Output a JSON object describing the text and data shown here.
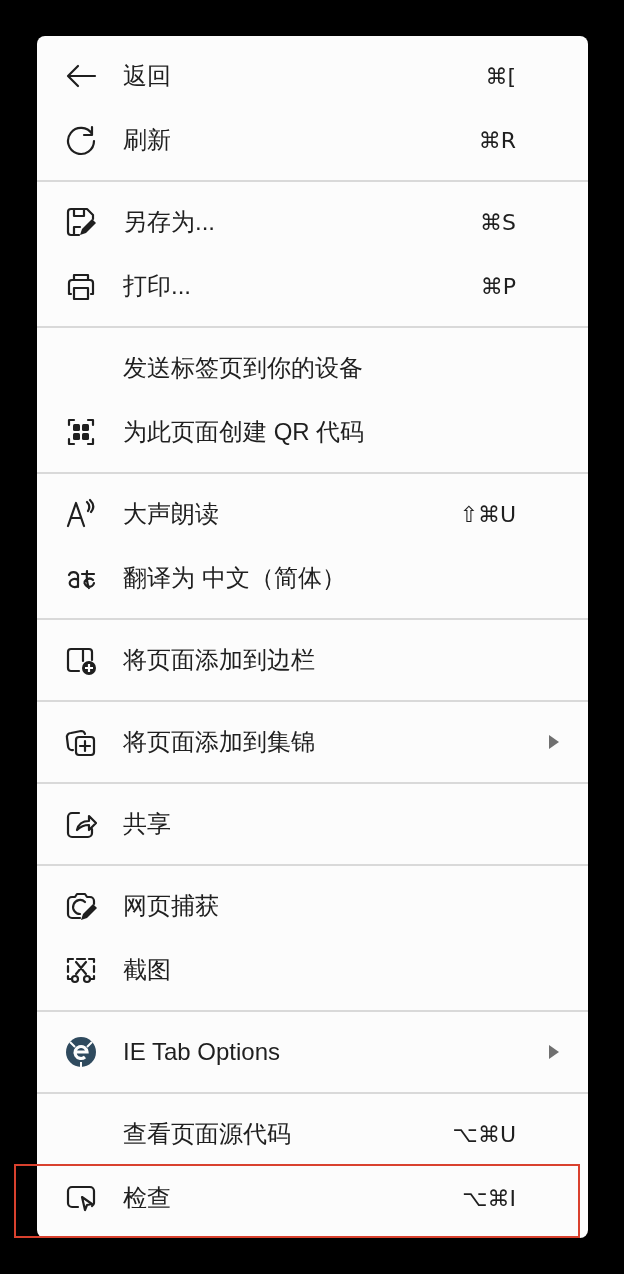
{
  "menu": {
    "groups": [
      {
        "items": [
          {
            "label": "返回",
            "shortcut": "⌘[",
            "submenu": false,
            "highlighted": false
          },
          {
            "label": "刷新",
            "shortcut": "⌘R",
            "submenu": false,
            "highlighted": false
          }
        ]
      },
      {
        "items": [
          {
            "label": "另存为...",
            "shortcut": "⌘S",
            "submenu": false,
            "highlighted": false
          },
          {
            "label": "打印...",
            "shortcut": "⌘P",
            "submenu": false,
            "highlighted": false
          }
        ]
      },
      {
        "items": [
          {
            "label": "发送标签页到你的设备",
            "submenu": false,
            "highlighted": false
          },
          {
            "label": "为此页面创建 QR 代码",
            "submenu": false,
            "highlighted": false
          }
        ]
      },
      {
        "items": [
          {
            "label": "大声朗读",
            "shortcut": "⇧⌘U",
            "submenu": false,
            "highlighted": false
          },
          {
            "label": "翻译为 中文（简体）",
            "submenu": false,
            "highlighted": false
          }
        ]
      },
      {
        "items": [
          {
            "label": "将页面添加到边栏",
            "submenu": false,
            "highlighted": false
          }
        ]
      },
      {
        "items": [
          {
            "label": "将页面添加到集锦",
            "submenu": true,
            "highlighted": false
          }
        ]
      },
      {
        "items": [
          {
            "label": "共享",
            "submenu": false,
            "highlighted": false
          }
        ]
      },
      {
        "items": [
          {
            "label": "网页捕获",
            "submenu": false,
            "highlighted": false
          },
          {
            "label": "截图",
            "submenu": false,
            "highlighted": false
          }
        ]
      },
      {
        "items": [
          {
            "label": "IE Tab Options",
            "submenu": true,
            "highlighted": false
          }
        ]
      },
      {
        "items": [
          {
            "label": "查看页面源代码",
            "shortcut": "⌥⌘U",
            "submenu": false,
            "highlighted": false
          },
          {
            "label": "检查",
            "shortcut": "⌥⌘I",
            "submenu": false,
            "highlighted": true
          }
        ]
      }
    ]
  }
}
